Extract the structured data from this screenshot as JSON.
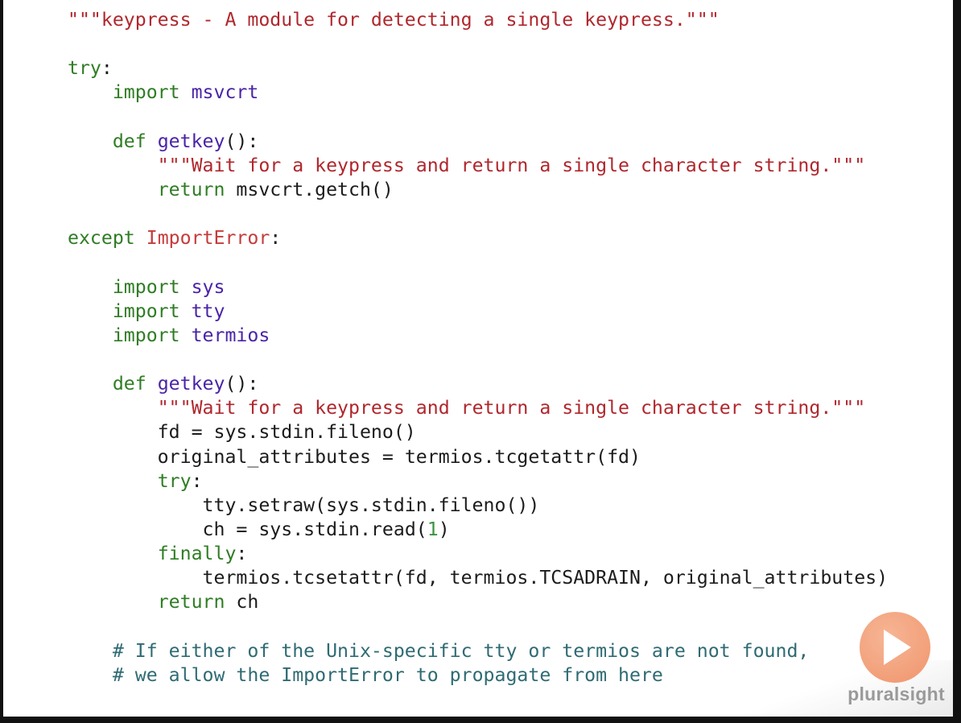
{
  "code_lines": [
    [
      {
        "t": "\"\"\"keypress - A module for detecting a single keypress.\"\"\"",
        "c": "str"
      }
    ],
    [],
    [
      {
        "t": "try",
        "c": "kw"
      },
      {
        "t": ":",
        "c": "punct"
      }
    ],
    [
      {
        "t": "    ",
        "c": "plain"
      },
      {
        "t": "import",
        "c": "kw"
      },
      {
        "t": " ",
        "c": "plain"
      },
      {
        "t": "msvcrt",
        "c": "mod"
      }
    ],
    [],
    [
      {
        "t": "    ",
        "c": "plain"
      },
      {
        "t": "def",
        "c": "kw"
      },
      {
        "t": " ",
        "c": "plain"
      },
      {
        "t": "getkey",
        "c": "fn"
      },
      {
        "t": "():",
        "c": "punct"
      }
    ],
    [
      {
        "t": "        ",
        "c": "plain"
      },
      {
        "t": "\"\"\"Wait for a keypress and return a single character string.\"\"\"",
        "c": "str"
      }
    ],
    [
      {
        "t": "        ",
        "c": "plain"
      },
      {
        "t": "return",
        "c": "kw"
      },
      {
        "t": " msvcrt.getch()",
        "c": "plain"
      }
    ],
    [],
    [
      {
        "t": "except",
        "c": "kw"
      },
      {
        "t": " ",
        "c": "plain"
      },
      {
        "t": "ImportError",
        "c": "exc"
      },
      {
        "t": ":",
        "c": "punct"
      }
    ],
    [],
    [
      {
        "t": "    ",
        "c": "plain"
      },
      {
        "t": "import",
        "c": "kw"
      },
      {
        "t": " ",
        "c": "plain"
      },
      {
        "t": "sys",
        "c": "mod"
      }
    ],
    [
      {
        "t": "    ",
        "c": "plain"
      },
      {
        "t": "import",
        "c": "kw"
      },
      {
        "t": " ",
        "c": "plain"
      },
      {
        "t": "tty",
        "c": "mod"
      }
    ],
    [
      {
        "t": "    ",
        "c": "plain"
      },
      {
        "t": "import",
        "c": "kw"
      },
      {
        "t": " ",
        "c": "plain"
      },
      {
        "t": "termios",
        "c": "mod"
      }
    ],
    [],
    [
      {
        "t": "    ",
        "c": "plain"
      },
      {
        "t": "def",
        "c": "kw"
      },
      {
        "t": " ",
        "c": "plain"
      },
      {
        "t": "getkey",
        "c": "fn"
      },
      {
        "t": "():",
        "c": "punct"
      }
    ],
    [
      {
        "t": "        ",
        "c": "plain"
      },
      {
        "t": "\"\"\"Wait for a keypress and return a single character string.\"\"\"",
        "c": "str"
      }
    ],
    [
      {
        "t": "        fd ",
        "c": "plain"
      },
      {
        "t": "=",
        "c": "op"
      },
      {
        "t": " sys.stdin.fileno()",
        "c": "plain"
      }
    ],
    [
      {
        "t": "        original_attributes ",
        "c": "plain"
      },
      {
        "t": "=",
        "c": "op"
      },
      {
        "t": " termios.tcgetattr(fd)",
        "c": "plain"
      }
    ],
    [
      {
        "t": "        ",
        "c": "plain"
      },
      {
        "t": "try",
        "c": "kw"
      },
      {
        "t": ":",
        "c": "punct"
      }
    ],
    [
      {
        "t": "            tty.setraw(sys.stdin.fileno())",
        "c": "plain"
      }
    ],
    [
      {
        "t": "            ch ",
        "c": "plain"
      },
      {
        "t": "=",
        "c": "op"
      },
      {
        "t": " sys.stdin.read(",
        "c": "plain"
      },
      {
        "t": "1",
        "c": "num"
      },
      {
        "t": ")",
        "c": "plain"
      }
    ],
    [
      {
        "t": "        ",
        "c": "plain"
      },
      {
        "t": "finally",
        "c": "kw"
      },
      {
        "t": ":",
        "c": "punct"
      }
    ],
    [
      {
        "t": "            termios.tcsetattr(fd, termios.TCSADRAIN, original_attributes)",
        "c": "plain"
      }
    ],
    [
      {
        "t": "        ",
        "c": "plain"
      },
      {
        "t": "return",
        "c": "kw"
      },
      {
        "t": " ch",
        "c": "plain"
      }
    ],
    [],
    [
      {
        "t": "    ",
        "c": "plain"
      },
      {
        "t": "# If either of the Unix-specific tty or termios are not found,",
        "c": "com"
      }
    ],
    [
      {
        "t": "    ",
        "c": "plain"
      },
      {
        "t": "# we allow the ImportError to propagate from here",
        "c": "com"
      }
    ]
  ],
  "logo": {
    "text": "pluralsight",
    "icon": "play-icon",
    "accent_color": "#ee8454"
  },
  "colors": {
    "string": "#b0272d",
    "keyword": "#2f7d24",
    "module": "#4a24a8",
    "exception": "#c63b3b",
    "number": "#3a9440",
    "comment": "#2f6b73",
    "text": "#1c1c1c"
  }
}
